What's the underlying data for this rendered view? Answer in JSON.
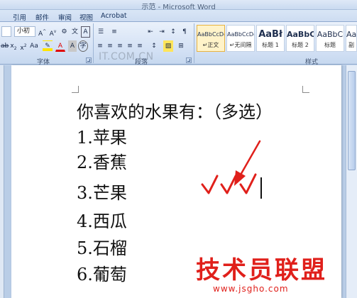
{
  "window": {
    "title": "示范 - Microsoft Word"
  },
  "tabs": [
    "引用",
    "邮件",
    "审阅",
    "视图",
    "Acrobat"
  ],
  "ribbon": {
    "font_size": "小初",
    "groups": {
      "font": "字体",
      "paragraph": "段落",
      "styles": "样式"
    },
    "styles": [
      {
        "preview": "AaBbCcDd",
        "name": "↵正文"
      },
      {
        "preview": "AaBbCcDd",
        "name": "↵无间隔"
      },
      {
        "preview": "AaBł",
        "name": "标题 1"
      },
      {
        "preview": "AaBbC",
        "name": "标题 2"
      },
      {
        "preview": "AaBbC",
        "name": "标题"
      },
      {
        "preview": "AaB",
        "name": "副"
      }
    ],
    "watermark": "IT.COM.CN"
  },
  "document": {
    "question": "你喜欢的水果有：（多选）",
    "options": [
      "1.苹果",
      "2.香蕉",
      "3.芒果",
      "4.西瓜",
      "5.石榴",
      "6.葡萄"
    ],
    "checkmarks": "√√√"
  },
  "branding": {
    "name": "技术员联盟",
    "url": "www.jsgho.com"
  },
  "colors": {
    "accent_red": "#e0201b",
    "ribbon_blue": "#cddcf1"
  }
}
